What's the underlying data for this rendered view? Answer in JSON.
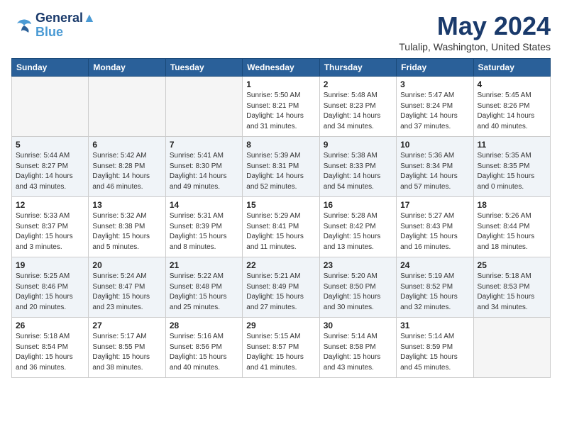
{
  "header": {
    "logo_line1": "General",
    "logo_line2": "Blue",
    "month_title": "May 2024",
    "location": "Tulalip, Washington, United States"
  },
  "weekdays": [
    "Sunday",
    "Monday",
    "Tuesday",
    "Wednesday",
    "Thursday",
    "Friday",
    "Saturday"
  ],
  "weeks": [
    [
      {
        "day": "",
        "empty": true
      },
      {
        "day": "",
        "empty": true
      },
      {
        "day": "",
        "empty": true
      },
      {
        "day": "1",
        "sunrise": "5:50 AM",
        "sunset": "8:21 PM",
        "daylight": "14 hours and 31 minutes."
      },
      {
        "day": "2",
        "sunrise": "5:48 AM",
        "sunset": "8:23 PM",
        "daylight": "14 hours and 34 minutes."
      },
      {
        "day": "3",
        "sunrise": "5:47 AM",
        "sunset": "8:24 PM",
        "daylight": "14 hours and 37 minutes."
      },
      {
        "day": "4",
        "sunrise": "5:45 AM",
        "sunset": "8:26 PM",
        "daylight": "14 hours and 40 minutes."
      }
    ],
    [
      {
        "day": "5",
        "sunrise": "5:44 AM",
        "sunset": "8:27 PM",
        "daylight": "14 hours and 43 minutes."
      },
      {
        "day": "6",
        "sunrise": "5:42 AM",
        "sunset": "8:28 PM",
        "daylight": "14 hours and 46 minutes."
      },
      {
        "day": "7",
        "sunrise": "5:41 AM",
        "sunset": "8:30 PM",
        "daylight": "14 hours and 49 minutes."
      },
      {
        "day": "8",
        "sunrise": "5:39 AM",
        "sunset": "8:31 PM",
        "daylight": "14 hours and 52 minutes."
      },
      {
        "day": "9",
        "sunrise": "5:38 AM",
        "sunset": "8:33 PM",
        "daylight": "14 hours and 54 minutes."
      },
      {
        "day": "10",
        "sunrise": "5:36 AM",
        "sunset": "8:34 PM",
        "daylight": "14 hours and 57 minutes."
      },
      {
        "day": "11",
        "sunrise": "5:35 AM",
        "sunset": "8:35 PM",
        "daylight": "15 hours and 0 minutes."
      }
    ],
    [
      {
        "day": "12",
        "sunrise": "5:33 AM",
        "sunset": "8:37 PM",
        "daylight": "15 hours and 3 minutes."
      },
      {
        "day": "13",
        "sunrise": "5:32 AM",
        "sunset": "8:38 PM",
        "daylight": "15 hours and 5 minutes."
      },
      {
        "day": "14",
        "sunrise": "5:31 AM",
        "sunset": "8:39 PM",
        "daylight": "15 hours and 8 minutes."
      },
      {
        "day": "15",
        "sunrise": "5:29 AM",
        "sunset": "8:41 PM",
        "daylight": "15 hours and 11 minutes."
      },
      {
        "day": "16",
        "sunrise": "5:28 AM",
        "sunset": "8:42 PM",
        "daylight": "15 hours and 13 minutes."
      },
      {
        "day": "17",
        "sunrise": "5:27 AM",
        "sunset": "8:43 PM",
        "daylight": "15 hours and 16 minutes."
      },
      {
        "day": "18",
        "sunrise": "5:26 AM",
        "sunset": "8:44 PM",
        "daylight": "15 hours and 18 minutes."
      }
    ],
    [
      {
        "day": "19",
        "sunrise": "5:25 AM",
        "sunset": "8:46 PM",
        "daylight": "15 hours and 20 minutes."
      },
      {
        "day": "20",
        "sunrise": "5:24 AM",
        "sunset": "8:47 PM",
        "daylight": "15 hours and 23 minutes."
      },
      {
        "day": "21",
        "sunrise": "5:22 AM",
        "sunset": "8:48 PM",
        "daylight": "15 hours and 25 minutes."
      },
      {
        "day": "22",
        "sunrise": "5:21 AM",
        "sunset": "8:49 PM",
        "daylight": "15 hours and 27 minutes."
      },
      {
        "day": "23",
        "sunrise": "5:20 AM",
        "sunset": "8:50 PM",
        "daylight": "15 hours and 30 minutes."
      },
      {
        "day": "24",
        "sunrise": "5:19 AM",
        "sunset": "8:52 PM",
        "daylight": "15 hours and 32 minutes."
      },
      {
        "day": "25",
        "sunrise": "5:18 AM",
        "sunset": "8:53 PM",
        "daylight": "15 hours and 34 minutes."
      }
    ],
    [
      {
        "day": "26",
        "sunrise": "5:18 AM",
        "sunset": "8:54 PM",
        "daylight": "15 hours and 36 minutes."
      },
      {
        "day": "27",
        "sunrise": "5:17 AM",
        "sunset": "8:55 PM",
        "daylight": "15 hours and 38 minutes."
      },
      {
        "day": "28",
        "sunrise": "5:16 AM",
        "sunset": "8:56 PM",
        "daylight": "15 hours and 40 minutes."
      },
      {
        "day": "29",
        "sunrise": "5:15 AM",
        "sunset": "8:57 PM",
        "daylight": "15 hours and 41 minutes."
      },
      {
        "day": "30",
        "sunrise": "5:14 AM",
        "sunset": "8:58 PM",
        "daylight": "15 hours and 43 minutes."
      },
      {
        "day": "31",
        "sunrise": "5:14 AM",
        "sunset": "8:59 PM",
        "daylight": "15 hours and 45 minutes."
      },
      {
        "day": "",
        "empty": true
      }
    ]
  ]
}
